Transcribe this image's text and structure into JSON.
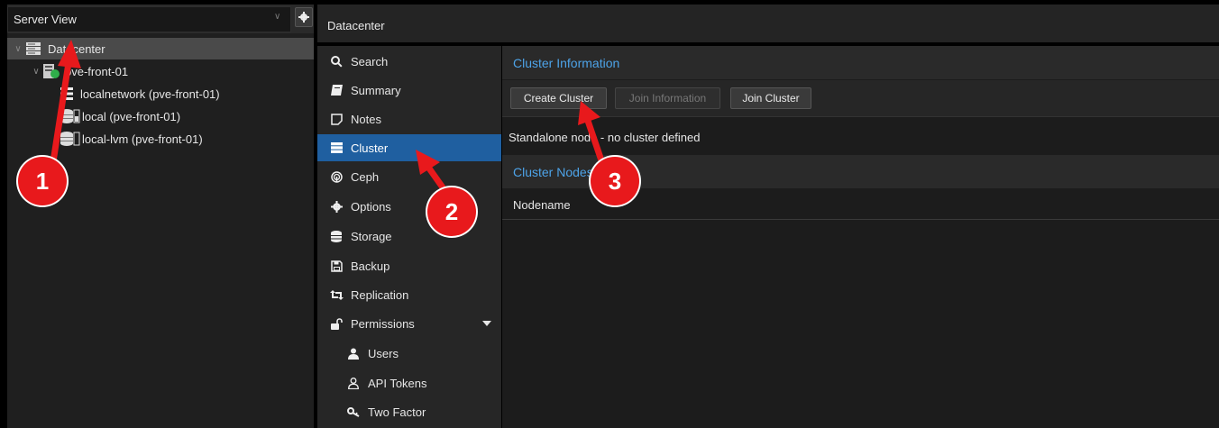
{
  "left_panel": {
    "view_label": "Server View",
    "tree": {
      "datacenter": "Datacenter",
      "node": "pve-front-01",
      "items": [
        {
          "label": "localnetwork (pve-front-01)",
          "icon": "network-icon"
        },
        {
          "label": "local (pve-front-01)",
          "icon": "storage-icon"
        },
        {
          "label": "local-lvm (pve-front-01)",
          "icon": "storage-icon"
        }
      ]
    }
  },
  "topbar": {
    "title": "Datacenter"
  },
  "nav": {
    "items": [
      {
        "label": "Search",
        "icon": "search-icon"
      },
      {
        "label": "Summary",
        "icon": "book-icon"
      },
      {
        "label": "Notes",
        "icon": "note-icon"
      },
      {
        "label": "Cluster",
        "icon": "server-icon",
        "active": true
      },
      {
        "label": "Ceph",
        "icon": "ceph-icon"
      },
      {
        "label": "Options",
        "icon": "gear-icon"
      },
      {
        "label": "Storage",
        "icon": "database-icon"
      },
      {
        "label": "Backup",
        "icon": "floppy-icon"
      },
      {
        "label": "Replication",
        "icon": "retweet-icon"
      },
      {
        "label": "Permissions",
        "icon": "unlock-icon"
      },
      {
        "label": "Users",
        "icon": "user-icon"
      },
      {
        "label": "API Tokens",
        "icon": "user-outline-icon"
      },
      {
        "label": "Two Factor",
        "icon": "key-icon"
      }
    ]
  },
  "content": {
    "cluster_info_title": "Cluster Information",
    "buttons": {
      "create": "Create Cluster",
      "join_info": "Join Information",
      "join": "Join Cluster"
    },
    "standalone_text": "Standalone node - no cluster defined",
    "cluster_nodes_title": "Cluster Nodes",
    "column_header": "Nodename"
  },
  "annotations": {
    "badge1": "1",
    "badge2": "2",
    "badge3": "3"
  },
  "colors": {
    "accent": "#1f5fa0",
    "heading": "#4da3e8",
    "badge": "#e8191c"
  }
}
